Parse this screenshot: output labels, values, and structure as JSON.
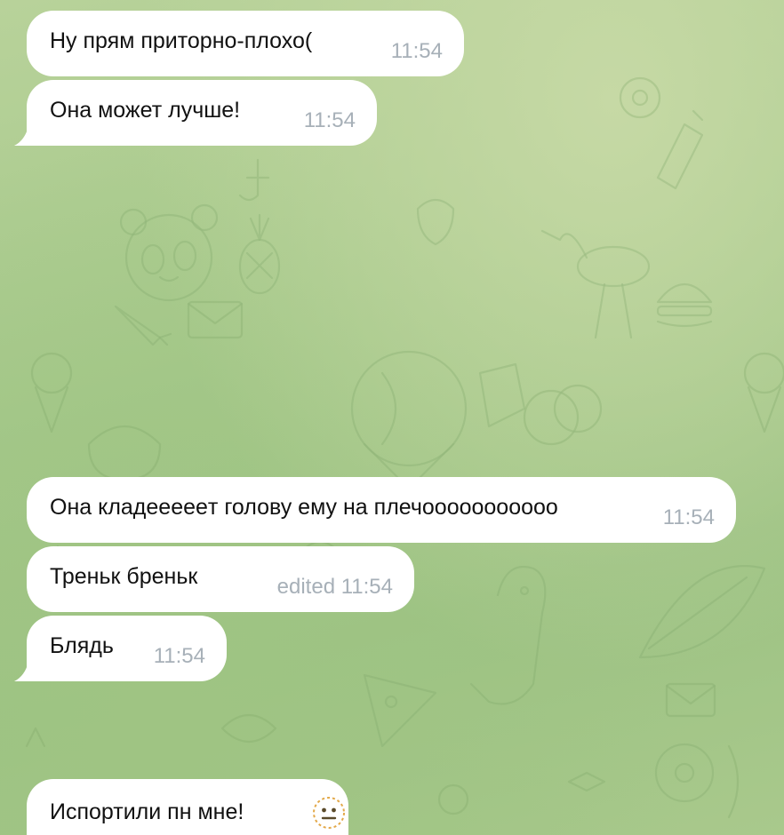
{
  "messages": [
    {
      "text": "Ну прям приторно-плохо(",
      "time": "11:54"
    },
    {
      "text": "Она может лучше!",
      "time": "11:54"
    },
    {
      "text": "Она кладеееeeт голову ему на плечооооооооооо",
      "time": "11:54"
    },
    {
      "text": "Треньк бреньк",
      "time": "edited 11:54"
    },
    {
      "text": "Блядь",
      "time": "11:54"
    },
    {
      "text": "Испортили пн мне!",
      "emoji": "neutral-face-emoji"
    }
  ],
  "colors": {
    "bubble": "#ffffff",
    "text": "#111111",
    "time": "#a7b0b8",
    "wallpaper": "#a6c98b"
  }
}
